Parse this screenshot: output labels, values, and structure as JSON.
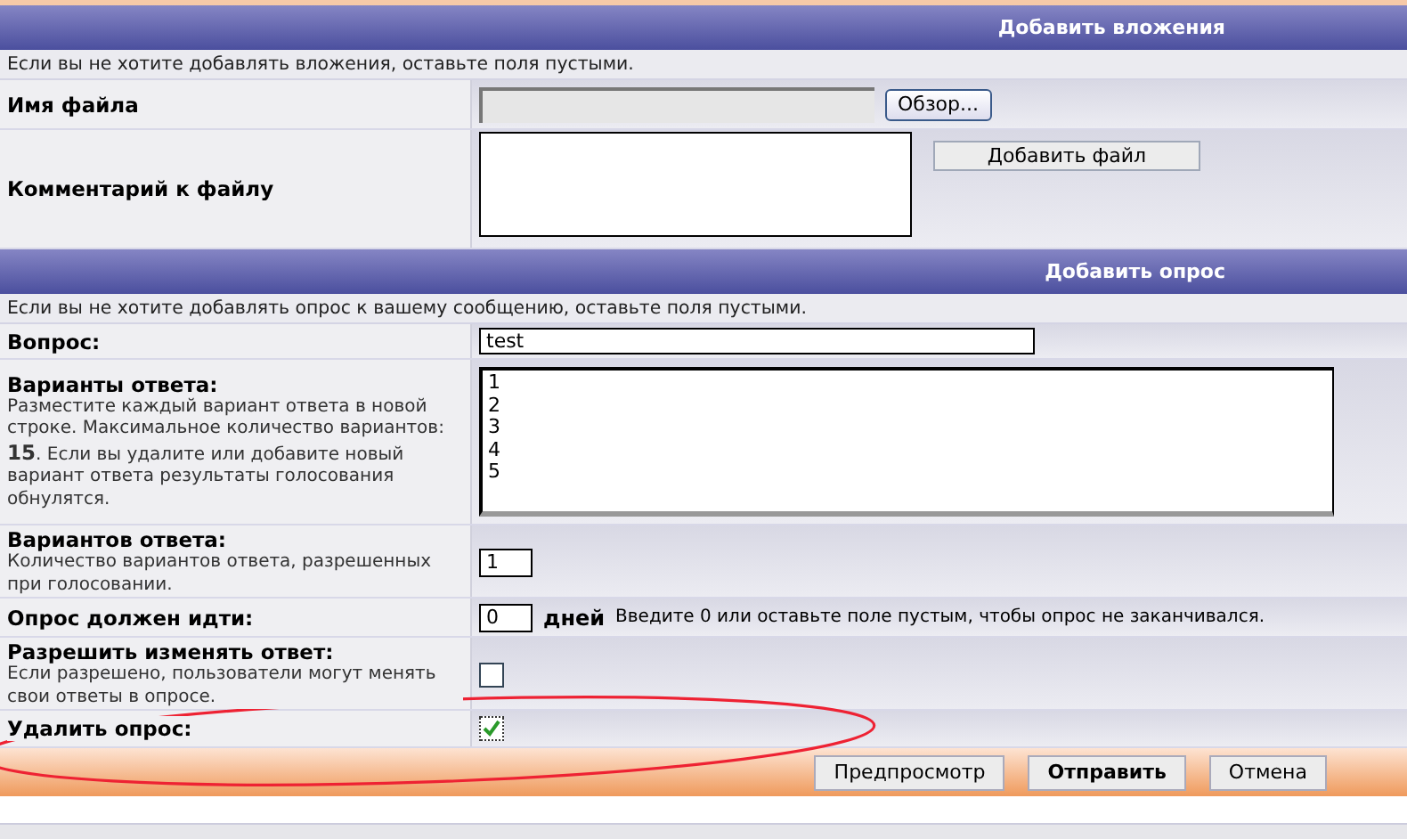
{
  "sections": [
    {
      "title": "Добавить вложения",
      "note": "Если вы не хотите добавлять вложения, оставьте поля пустыми.",
      "rows": [
        {
          "kind": "file",
          "label": "Имя файла",
          "button": "Обзор..."
        },
        {
          "kind": "comment",
          "label": "Комментарий к файлу",
          "button": "Добавить файл"
        }
      ]
    },
    {
      "title": "Добавить опрос",
      "note": "Если вы не хотите добавлять опрос к вашему сообщению, оставьте поля пустыми.",
      "rows": [
        {
          "kind": "text",
          "label": "Вопрос:",
          "value": "test"
        },
        {
          "kind": "textarea",
          "label": "Варианты ответа:",
          "description": "Разместите каждый вариант ответа в новой строке. Максимальное количество вариантов: **15**. Если вы удалите или добавите новый вариант ответа результаты голосования обнулятся.",
          "lines": [
            "1",
            "2",
            "3",
            "4",
            "5"
          ]
        },
        {
          "kind": "number",
          "label": "Вариантов ответа:",
          "description": "Количество вариантов ответа, разрешенных при голосовании.",
          "value": "1"
        },
        {
          "kind": "duration",
          "label": "Опрос должен идти:",
          "value": "0",
          "unit": "дней",
          "hint": "Введите 0 или оставьте поле пустым, чтобы опрос не заканчивался."
        },
        {
          "kind": "checkbox",
          "label": "Разрешить изменять ответ:",
          "description": "Если разрешено, пользователи могут менять свои ответы в опросе.",
          "checked": false
        },
        {
          "kind": "checkbox",
          "label": "Удалить опрос:",
          "checked": true
        }
      ]
    }
  ],
  "buttons": [
    {
      "label": "Предпросмотр",
      "default": false
    },
    {
      "label": "Отправить",
      "default": true
    },
    {
      "label": "Отмена",
      "default": false
    }
  ]
}
